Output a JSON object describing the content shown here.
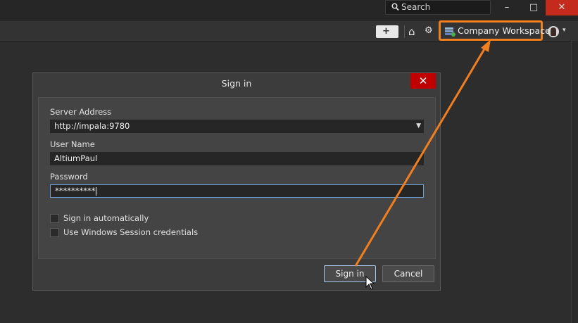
{
  "titlebar": {
    "search_label": "Search",
    "minimize": "–",
    "maximize": "□",
    "close": "✕"
  },
  "toolbar": {
    "workspace_label": "Company Workspace",
    "home_glyph": "⌂",
    "settings_glyph": "⚙",
    "message_glyph": "+",
    "avatar_dropdown": "▾"
  },
  "dialog": {
    "title": "Sign in",
    "close_glyph": "✕",
    "server_label": "Server Address",
    "server_value": "http://impala:9780",
    "username_label": "User Name",
    "username_value": "AltiumPaul",
    "password_label": "Password",
    "password_value": "**********",
    "auto_sign_in_label": "Sign in automatically",
    "windows_session_label": "Use Windows Session credentials",
    "sign_in_button": "Sign in",
    "cancel_button": "Cancel",
    "dropdown_glyph": "▼"
  },
  "colors": {
    "accent_orange": "#f07f1f",
    "close_red": "#c00000",
    "background": "#2d2d2d"
  }
}
